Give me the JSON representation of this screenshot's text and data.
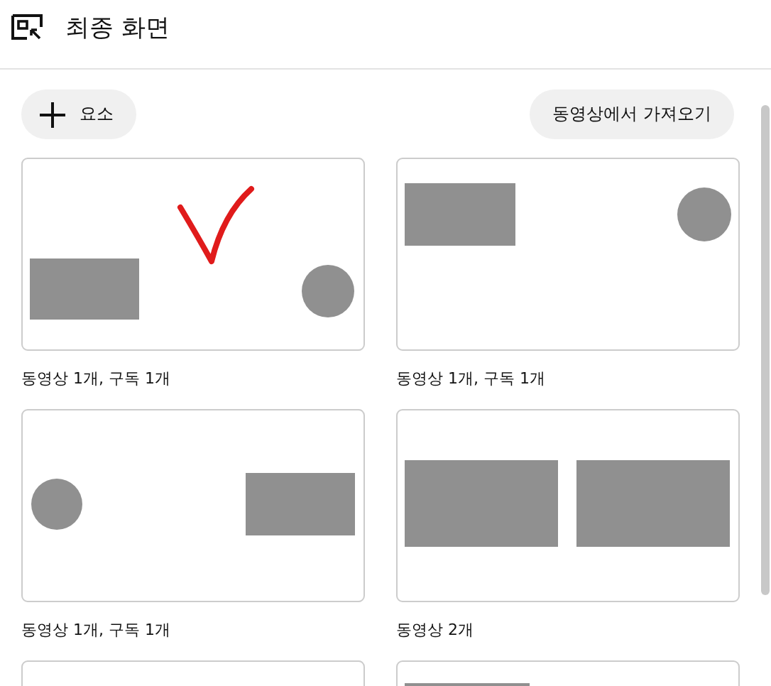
{
  "header": {
    "title": "최종 화면"
  },
  "toolbar": {
    "add_button": "요소",
    "import_button": "동영상에서 가져오기"
  },
  "templates": [
    {
      "kind": "video-bottom-left",
      "caption": "동영상 1개, 구독 1개"
    },
    {
      "kind": "video-top-left",
      "caption": "동영상 1개, 구독 1개"
    },
    {
      "kind": "video-right",
      "caption": "동영상 1개, 구독 1개"
    },
    {
      "kind": "two-videos",
      "caption": "동영상 2개"
    },
    {
      "kind": "blank"
    },
    {
      "kind": "video-corner"
    }
  ]
}
